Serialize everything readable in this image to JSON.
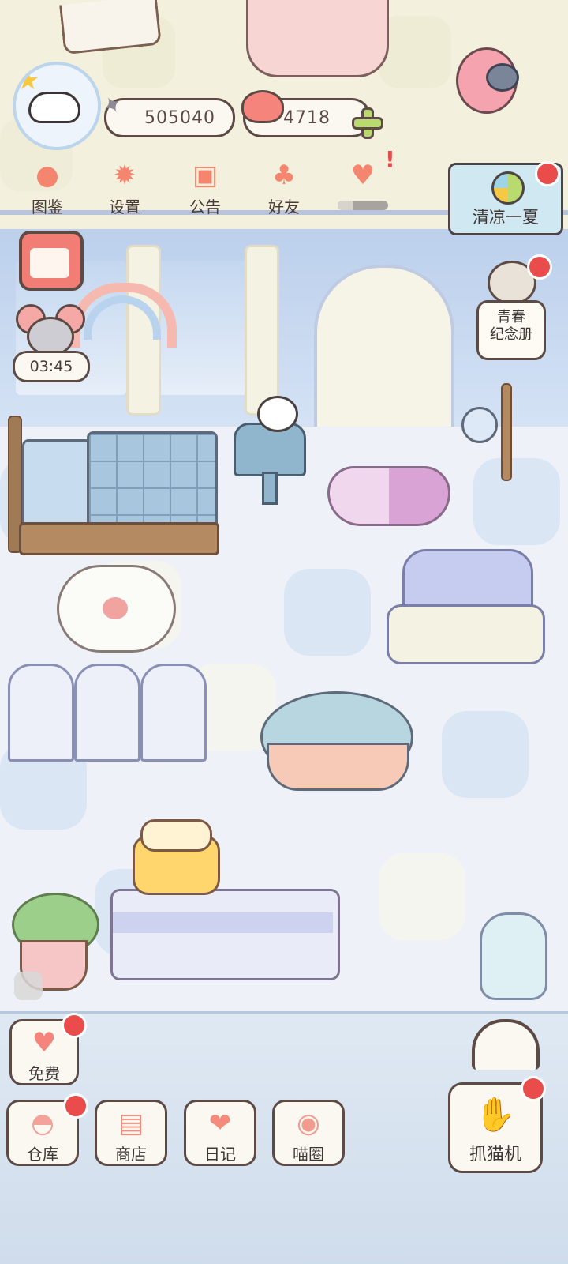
{
  "currencies": {
    "fish": {
      "icon": "fish-icon",
      "value": "505040"
    },
    "hearts": {
      "icon": "heart-icon",
      "value": "4718",
      "add_icon": "plus-icon"
    }
  },
  "top_nav": [
    {
      "label": "图鉴",
      "icon": "cat-head-icon"
    },
    {
      "label": "设置",
      "icon": "gear-icon"
    },
    {
      "label": "公告",
      "icon": "gift-icon"
    },
    {
      "label": "好友",
      "icon": "friends-icon"
    }
  ],
  "event_banner": {
    "label": "清凉一夏"
  },
  "timer": {
    "value": "03:45"
  },
  "album": {
    "label": "青春\n纪念册"
  },
  "free_button": {
    "label": "免费"
  },
  "bottom_nav": [
    {
      "label": "仓库",
      "icon": "storage-icon"
    },
    {
      "label": "商店",
      "icon": "shop-icon"
    },
    {
      "label": "日记",
      "icon": "diary-icon"
    },
    {
      "label": "喵圈",
      "icon": "cat-planet-icon"
    }
  ],
  "claw_machine": {
    "label": "抓猫机"
  },
  "colors": {
    "accent": "#f4856f",
    "badge": "#ea4c4c",
    "outline": "#5e4a44"
  }
}
